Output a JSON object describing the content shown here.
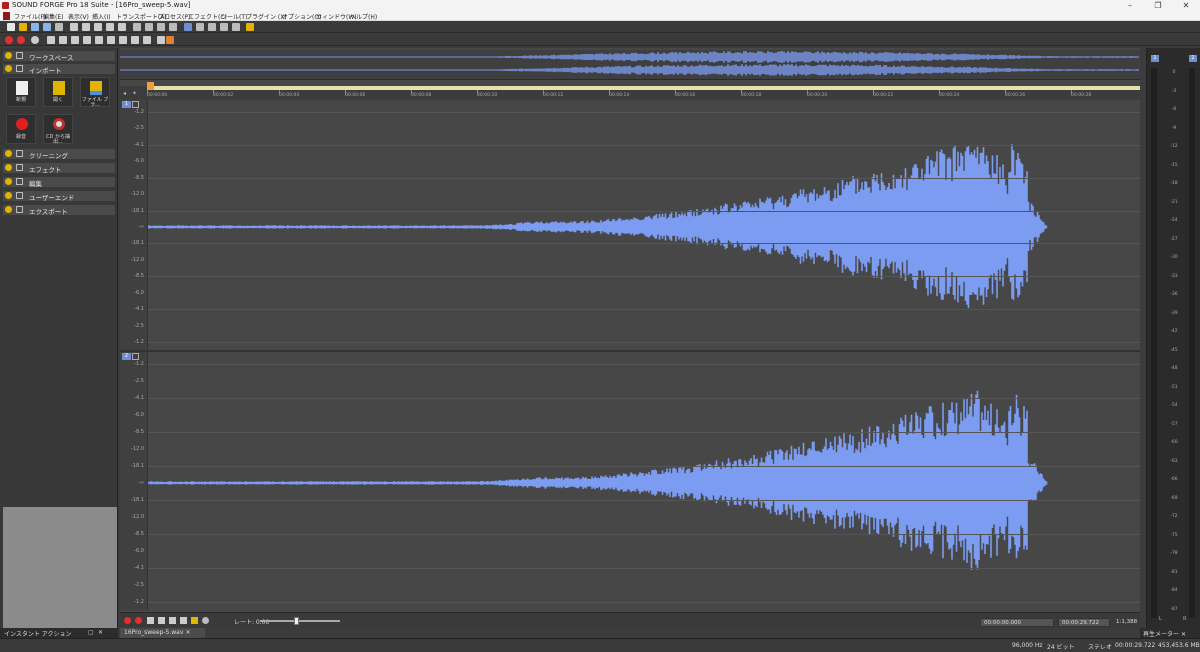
{
  "window": {
    "title": "SOUND FORGE Pro 18 Suite - [16Pro_sweep-5.wav]"
  },
  "menu": [
    "ファイル(F)",
    "編集(E)",
    "表示(V)",
    "挿入(I)",
    "トランスポート(A)",
    "プロセス(P)",
    "エフェクト(C)",
    "ツール(T)",
    "プラグイン (X)",
    "オプション(O)",
    "ウィンドウ(W)",
    "ヘルプ(H)"
  ],
  "left_panel": {
    "sections_top": [
      "ワークスペース",
      "インポート"
    ],
    "import_tiles": [
      {
        "label": "新規",
        "icon": "new-file-icon"
      },
      {
        "label": "開く",
        "icon": "open-folder-icon"
      },
      {
        "label": "ファイル ブラ...",
        "icon": "file-browser-icon"
      },
      {
        "label": "録音",
        "icon": "record-icon"
      },
      {
        "label": "CD から抽出...",
        "icon": "cd-extract-icon"
      }
    ],
    "sections_bottom": [
      "クリーニング",
      "エフェクト",
      "編集",
      "ユーザーエンド",
      "エクスポート"
    ],
    "tab_label": "インスタント アクション"
  },
  "ruler": {
    "ticks": [
      "00:00:00",
      "00:00:02",
      "00:00:04",
      "00:00:06",
      "00:00:08",
      "00:00:10",
      "00:00:12",
      "00:00:14",
      "00:00:16",
      "00:00:18",
      "00:00:20",
      "00:00:22",
      "00:00:24",
      "00:00:26",
      "00:00:28"
    ]
  },
  "channels": [
    {
      "number": "1",
      "db_labels": [
        "-1.2",
        "-2.5",
        "-4.1",
        "-6.0",
        "-8.5",
        "-12.0",
        "-18.1",
        "-∞",
        "-18.1",
        "-12.0",
        "-8.5",
        "-6.0",
        "-4.1",
        "-2.5",
        "-1.2"
      ]
    },
    {
      "number": "2",
      "db_labels": [
        "-1.2",
        "-2.5",
        "-4.1",
        "-6.0",
        "-8.5",
        "-12.0",
        "-18.1",
        "-∞",
        "-18.1",
        "-12.0",
        "-8.5",
        "-6.0",
        "-4.1",
        "-2.5",
        "-1.2"
      ]
    }
  ],
  "transport": {
    "rate_label": "レート: 0.00",
    "selection_start": "00:00:00.000",
    "selection_end": "00:00:29.722",
    "zoom": "1:1,388"
  },
  "document_tab": "16Pro_sweep-5.wav",
  "meter_panel": {
    "channel_caps": [
      "1",
      "2"
    ],
    "scale": [
      "0",
      "-3",
      "-6",
      "-9",
      "-12",
      "-15",
      "-18",
      "-21",
      "-24",
      "-27",
      "-30",
      "-33",
      "-36",
      "-39",
      "-42",
      "-45",
      "-48",
      "-51",
      "-54",
      "-57",
      "-60",
      "-63",
      "-66",
      "-69",
      "-72",
      "-75",
      "-78",
      "-81",
      "-84",
      "-87"
    ],
    "footer": [
      "L",
      "R"
    ],
    "tab_label": "再生メーター"
  },
  "status": {
    "sample_rate": "96,000 Hz",
    "bit_depth": "24 ビット",
    "channels": "ステレオ",
    "length": "00:00:29.722",
    "disk": "453,453.6 MB"
  },
  "colors": {
    "waveform": "#7b9cf0",
    "background": "#474747",
    "accent": "#e0b400"
  }
}
